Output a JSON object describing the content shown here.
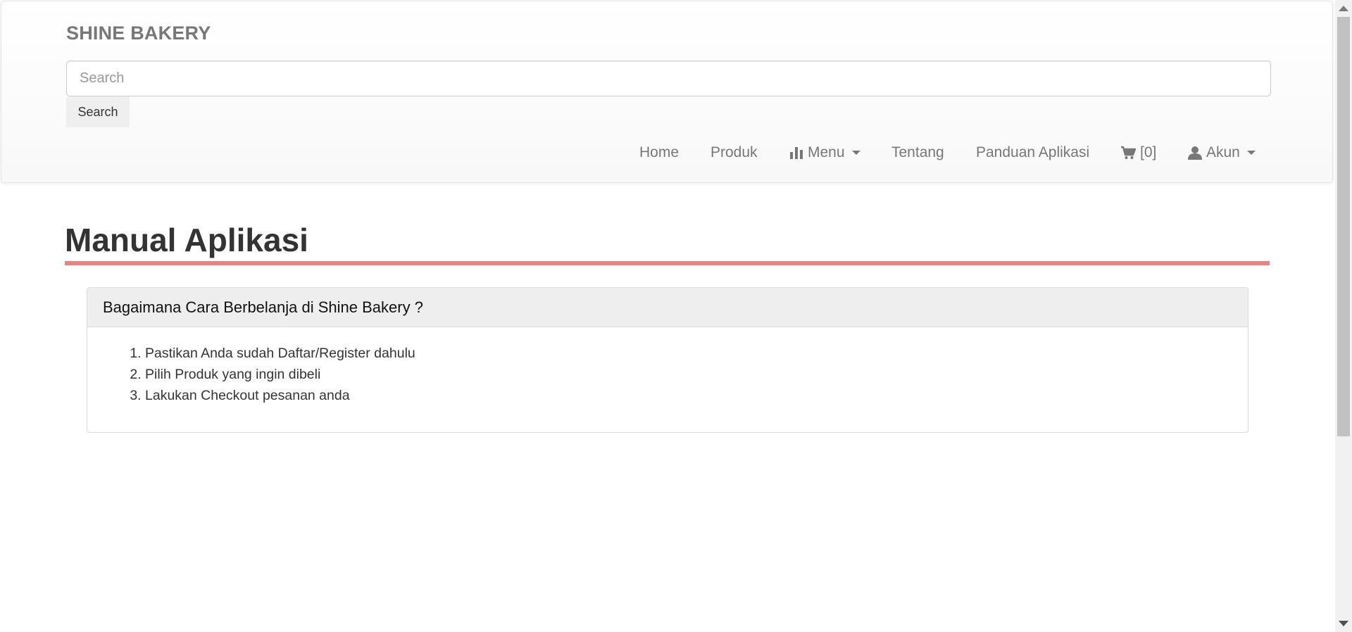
{
  "header": {
    "brand": "SHINE BAKERY",
    "search_placeholder": "Search",
    "search_button_label": "Search"
  },
  "nav": {
    "home": "Home",
    "produk": "Produk",
    "menu": "Menu",
    "tentang": "Tentang",
    "panduan": "Panduan Aplikasi",
    "cart": "[0]",
    "akun": "Akun",
    "icons": [
      "bar-chart-icon",
      "cart-icon",
      "user-icon",
      "caret-down-icon"
    ]
  },
  "main": {
    "title": "Manual Aplikasi",
    "accent_color": "#f08080",
    "panel": {
      "heading": "Bagaimana Cara Berbelanja di Shine Bakery ?",
      "steps": [
        "Pastikan Anda sudah Daftar/Register dahulu",
        "Pilih Produk yang ingin dibeli",
        "Lakukan Checkout pesanan anda"
      ]
    }
  }
}
